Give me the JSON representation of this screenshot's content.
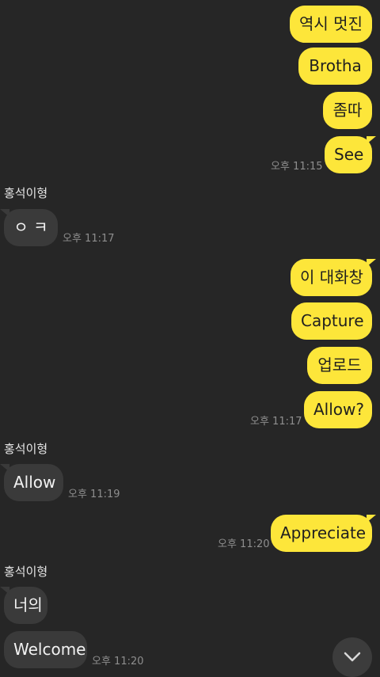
{
  "chat": {
    "messages": [
      {
        "text": "역시 멋진"
      },
      {
        "text": "Brotha"
      },
      {
        "text": "좀따"
      },
      {
        "text": "See",
        "time": "오후 11:15"
      },
      {
        "sender": "홍석이형",
        "text": "ㅇ ㅋ",
        "time": "오후 11:17"
      },
      {
        "text": "이 대화창"
      },
      {
        "text": "Capture"
      },
      {
        "text": "업로드"
      },
      {
        "text": "Allow?",
        "time": "오후 11:17"
      },
      {
        "sender": "홍석이형",
        "text": "Allow",
        "time": "오후 11:19"
      },
      {
        "text": "Appreciate",
        "time": "오후 11:20"
      },
      {
        "sender": "홍석이형",
        "text": "너의"
      },
      {
        "text": "Welcome",
        "time": "오후 11:20"
      }
    ]
  },
  "icons": {
    "scroll_down": "chevron-down-icon"
  },
  "colors": {
    "background": "#262626",
    "sent_bubble": "#fde63a",
    "received_bubble": "#3a3a3a",
    "timestamp": "#8e8e8e"
  }
}
